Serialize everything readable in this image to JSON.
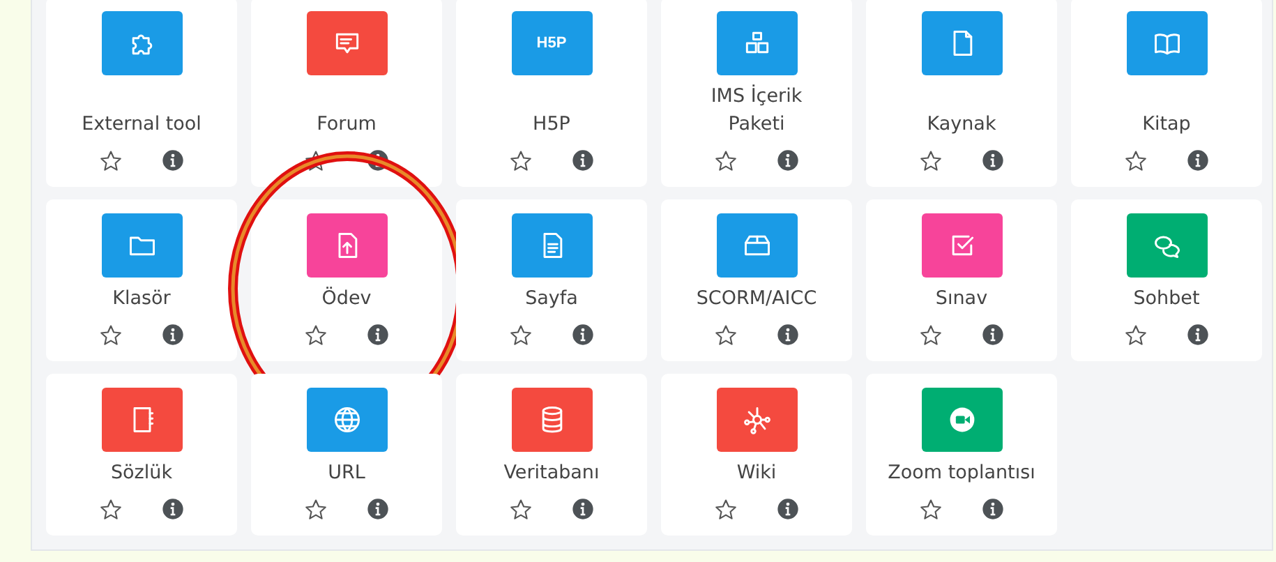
{
  "activities": [
    {
      "name": "External tool",
      "kind": "puzzle",
      "color": "#1a9be6",
      "highlighted": false
    },
    {
      "name": "Forum",
      "kind": "message",
      "color": "#f44a3f",
      "highlighted": false
    },
    {
      "name": "H5P",
      "kind": "logo",
      "logo_text": "H5P",
      "color": "#1a9be6",
      "highlighted": false
    },
    {
      "name": "IMS İçerik Paketi",
      "kind": "boxes",
      "color": "#1a9be6",
      "highlighted": false
    },
    {
      "name": "Kaynak",
      "kind": "file",
      "color": "#1a9be6",
      "highlighted": false
    },
    {
      "name": "Kitap",
      "kind": "book",
      "color": "#1a9be6",
      "highlighted": false
    },
    {
      "name": "Klasör",
      "kind": "folder",
      "color": "#1a9be6",
      "highlighted": false
    },
    {
      "name": "Ödev",
      "kind": "upload",
      "color": "#f7449a",
      "highlighted": true
    },
    {
      "name": "Sayfa",
      "kind": "document",
      "color": "#1a9be6",
      "highlighted": false
    },
    {
      "name": "SCORM/AICC",
      "kind": "box",
      "color": "#1a9be6",
      "highlighted": false
    },
    {
      "name": "Sınav",
      "kind": "checkbox",
      "color": "#f7449a",
      "highlighted": false
    },
    {
      "name": "Sohbet",
      "kind": "chats",
      "color": "#00ae72",
      "highlighted": false
    },
    {
      "name": "Sözlük",
      "kind": "notebook",
      "color": "#f44a3f",
      "highlighted": false
    },
    {
      "name": "URL",
      "kind": "globe",
      "color": "#1a9be6",
      "highlighted": false
    },
    {
      "name": "Veritabanı",
      "kind": "database",
      "color": "#f44a3f",
      "highlighted": false
    },
    {
      "name": "Wiki",
      "kind": "network",
      "color": "#f44a3f",
      "highlighted": false
    },
    {
      "name": "Zoom toplantısı",
      "kind": "video",
      "color": "#00ae72",
      "highlighted": false
    }
  ]
}
